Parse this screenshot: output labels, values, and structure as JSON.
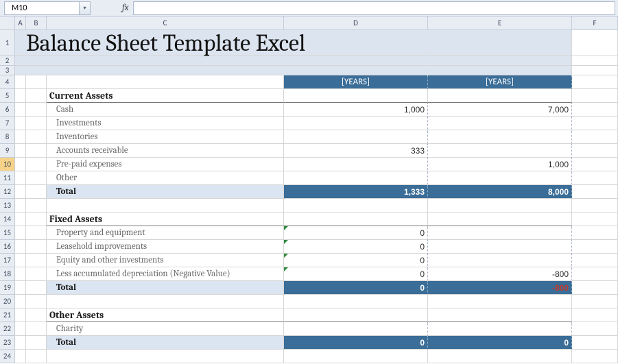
{
  "formula_bar": {
    "name_box": "M10",
    "fx_label": "fx"
  },
  "columns": [
    "A",
    "B",
    "C",
    "D",
    "E",
    "F"
  ],
  "rows": [
    "1",
    "2",
    "3",
    "4",
    "5",
    "6",
    "7",
    "8",
    "9",
    "10",
    "11",
    "12",
    "13",
    "14",
    "15",
    "16",
    "17",
    "18",
    "19",
    "20",
    "21",
    "22",
    "23",
    "24"
  ],
  "selected_row": "10",
  "title": "Balance Sheet Template Excel",
  "header": {
    "col_d": "[YEARS]",
    "col_e": "[YEARS]"
  },
  "sections": {
    "current_assets": {
      "heading": "Current Assets",
      "items": [
        {
          "label": "Cash",
          "d": "1,000",
          "e": "7,000"
        },
        {
          "label": "Investments",
          "d": "",
          "e": ""
        },
        {
          "label": "Inventories",
          "d": "",
          "e": ""
        },
        {
          "label": "Accounts receivable",
          "d": "333",
          "e": ""
        },
        {
          "label": "Pre-paid expenses",
          "d": "",
          "e": "1,000"
        },
        {
          "label": "Other",
          "d": "",
          "e": ""
        }
      ],
      "total_label": "Total",
      "total": {
        "d": "1,333",
        "e": "8,000"
      }
    },
    "fixed_assets": {
      "heading": "Fixed Assets",
      "items": [
        {
          "label": "Property and equipment",
          "d": "0",
          "e": ""
        },
        {
          "label": "Leasehold improvements",
          "d": "0",
          "e": ""
        },
        {
          "label": "Equity and other investments",
          "d": "0",
          "e": ""
        },
        {
          "label": "Less accumulated depreciation (Negative Value)",
          "d": "0",
          "e": "-800"
        }
      ],
      "total_label": "Total",
      "total": {
        "d": "0",
        "e": "-800"
      }
    },
    "other_assets": {
      "heading": "Other Assets",
      "items": [
        {
          "label": "Charity",
          "d": "",
          "e": ""
        }
      ],
      "total_label": "Total",
      "total": {
        "d": "0",
        "e": "0"
      }
    }
  },
  "chart_data": {
    "type": "table",
    "title": "Balance Sheet Template Excel",
    "columns": [
      "Item",
      "[YEARS]",
      "[YEARS]"
    ],
    "sections": [
      {
        "name": "Current Assets",
        "rows": [
          [
            "Cash",
            1000,
            7000
          ],
          [
            "Investments",
            null,
            null
          ],
          [
            "Inventories",
            null,
            null
          ],
          [
            "Accounts receivable",
            333,
            null
          ],
          [
            "Pre-paid expenses",
            null,
            1000
          ],
          [
            "Other",
            null,
            null
          ]
        ],
        "total": [
          1333,
          8000
        ]
      },
      {
        "name": "Fixed Assets",
        "rows": [
          [
            "Property and equipment",
            0,
            null
          ],
          [
            "Leasehold improvements",
            0,
            null
          ],
          [
            "Equity and other investments",
            0,
            null
          ],
          [
            "Less accumulated depreciation (Negative Value)",
            0,
            -800
          ]
        ],
        "total": [
          0,
          -800
        ]
      },
      {
        "name": "Other Assets",
        "rows": [
          [
            "Charity",
            null,
            null
          ]
        ],
        "total": [
          0,
          0
        ]
      }
    ]
  }
}
